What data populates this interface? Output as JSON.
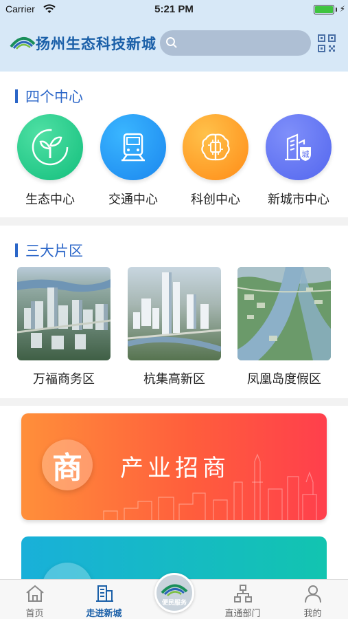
{
  "status_bar": {
    "carrier": "Carrier",
    "time": "5:21 PM",
    "battery_level": 1.0,
    "battery_color": "#3fc440"
  },
  "header": {
    "logo_text": "扬州生态科技新城",
    "search_placeholder": "",
    "search_icon": "search-icon",
    "qr_icon": "qr-code-icon"
  },
  "centers": {
    "title": "四个中心",
    "items": [
      {
        "label": "生态中心",
        "icon": "leaf-icon",
        "color": "#1ecb8a"
      },
      {
        "label": "交通中心",
        "icon": "train-icon",
        "color": "#1b8ff0"
      },
      {
        "label": "科创中心",
        "icon": "brain-chip-icon",
        "color": "#ff9b1f"
      },
      {
        "label": "新城市中心",
        "icon": "city-building-icon",
        "color": "#5a6ff0"
      }
    ]
  },
  "districts": {
    "title": "三大片区",
    "items": [
      {
        "label": "万福商务区",
        "image": "aerial-business-district-image"
      },
      {
        "label": "杭集高新区",
        "image": "aerial-tech-district-image"
      },
      {
        "label": "凤凰岛度假区",
        "image": "aerial-island-resort-image"
      }
    ]
  },
  "banners": [
    {
      "title": "产业招商",
      "badge": "商",
      "icon": "business-badge-icon",
      "color": "#ff5e3c"
    },
    {
      "title": "",
      "badge": "",
      "icon": "",
      "color": "#12c4b0"
    }
  ],
  "tab_bar": {
    "items": [
      {
        "label": "首页",
        "icon": "home-icon",
        "active": false
      },
      {
        "label": "走进新城",
        "icon": "building-icon",
        "active": true
      },
      {
        "label": "便民服务",
        "icon": "logo-service-icon",
        "active": false
      },
      {
        "label": "直通部门",
        "icon": "org-chart-icon",
        "active": false
      },
      {
        "label": "我的",
        "icon": "user-icon",
        "active": false
      }
    ],
    "active_color": "#1a5fa8"
  }
}
